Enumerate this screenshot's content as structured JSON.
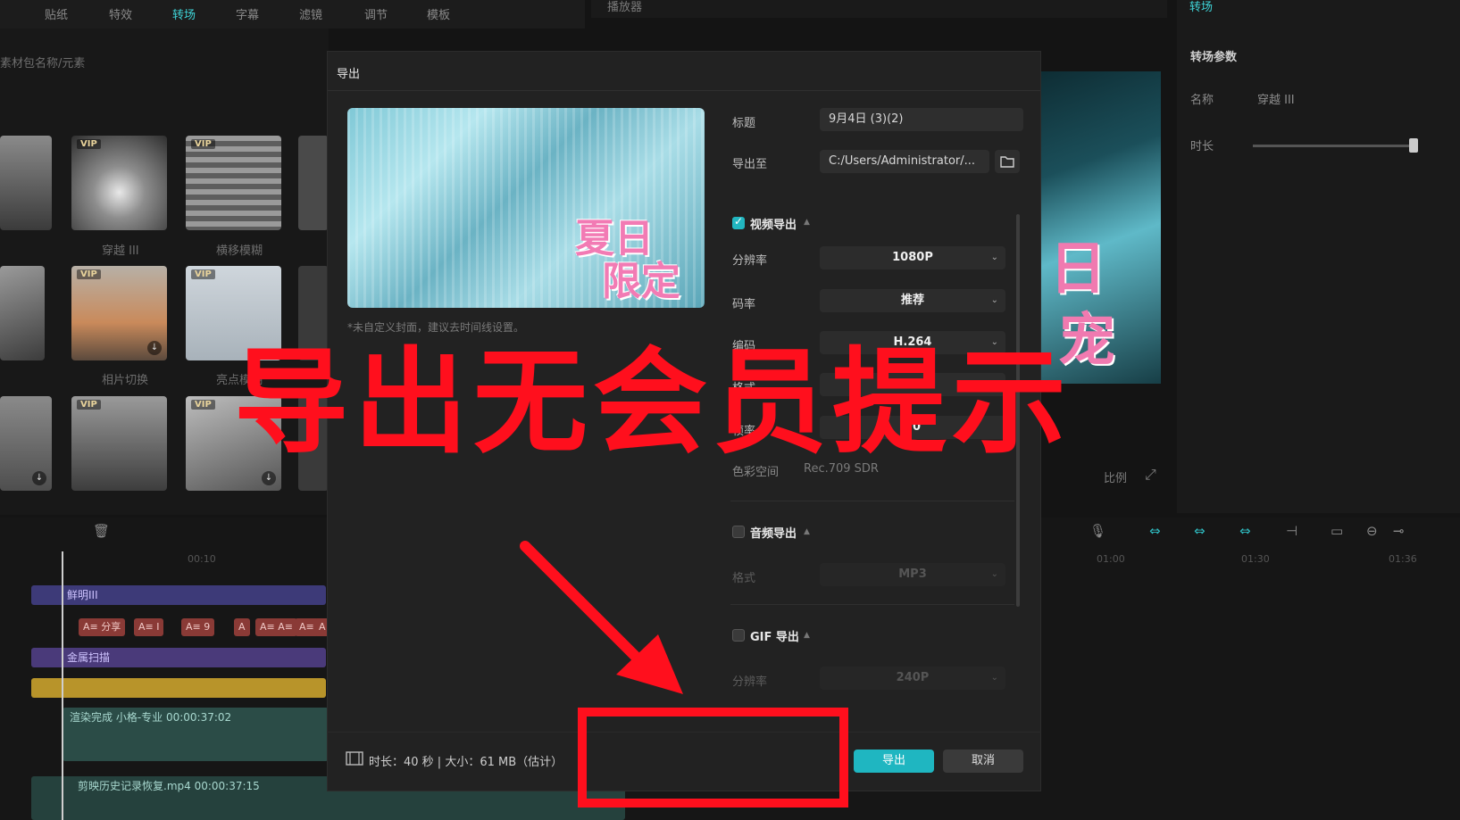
{
  "editor": {
    "top_tabs": [
      "贴纸",
      "特效",
      "转场",
      "字幕",
      "滤镜",
      "调节",
      "模板"
    ],
    "active_tab": "转场",
    "breadcrumb": "素材包名称/元素",
    "thumbs": [
      {
        "vip": "VIP",
        "caption": "穿越 III"
      },
      {
        "vip": "VIP",
        "caption": "横移模糊"
      },
      {
        "vip": "VIP",
        "caption": "相片切换"
      },
      {
        "vip": "VIP",
        "caption": "亮点模糊"
      }
    ],
    "player_title": "播放器",
    "player_ratio": "比例",
    "right_panel": {
      "tab": "转场",
      "section": "转场参数",
      "name_label": "名称",
      "name_value": "穿越 III",
      "duration_label": "时长"
    },
    "timeline": {
      "ruler": [
        "00:10",
        "01:00",
        "01:30",
        "01:36"
      ],
      "track1": "鲜明III",
      "track2": "金属扫描",
      "chips": [
        "A≡ 分享",
        "A≡ I",
        "A≡ 9",
        "A",
        "A≡ A≡",
        "A≡",
        "A"
      ],
      "clip1": "渲染完成  小格-专业  00:00:37:02",
      "clip2": "剪映历史记录恢复.mp4  00:00:37:15"
    }
  },
  "dialog": {
    "title": "导出",
    "cover_hint": "*未自定义封面，建议去时间线设置。",
    "title_label": "标题",
    "title_value": "9月4日 (3)(2)",
    "export_to_label": "导出至",
    "export_to_value": "C:/Users/Administrator/...",
    "video_section": "视频导出",
    "video_checked": true,
    "resolution_label": "分辨率",
    "resolution_value": "1080P",
    "bitrate_label": "码率",
    "bitrate_value": "推荐",
    "codec_label": "编码",
    "codec_value": "H.264",
    "format_label": "格式",
    "framerate_label": "帧率",
    "framerate_value": "30",
    "colorspace_label": "色彩空间",
    "colorspace_value": "Rec.709 SDR",
    "audio_section": "音频导出",
    "audio_checked": false,
    "audio_format_label": "格式",
    "audio_format_value": "MP3",
    "gif_section": "GIF 导出",
    "gif_checked": false,
    "gif_res_label": "分辨率",
    "gif_res_value": "240P",
    "footer_info": "时长：40 秒 | 大小：61 MB（估计）",
    "export_button": "导出",
    "cancel_button": "取消"
  },
  "overlay": {
    "caption": "导出无会员提示"
  },
  "colors": {
    "accent": "#1fb6c1",
    "annotation_red": "#ff0f1d"
  }
}
